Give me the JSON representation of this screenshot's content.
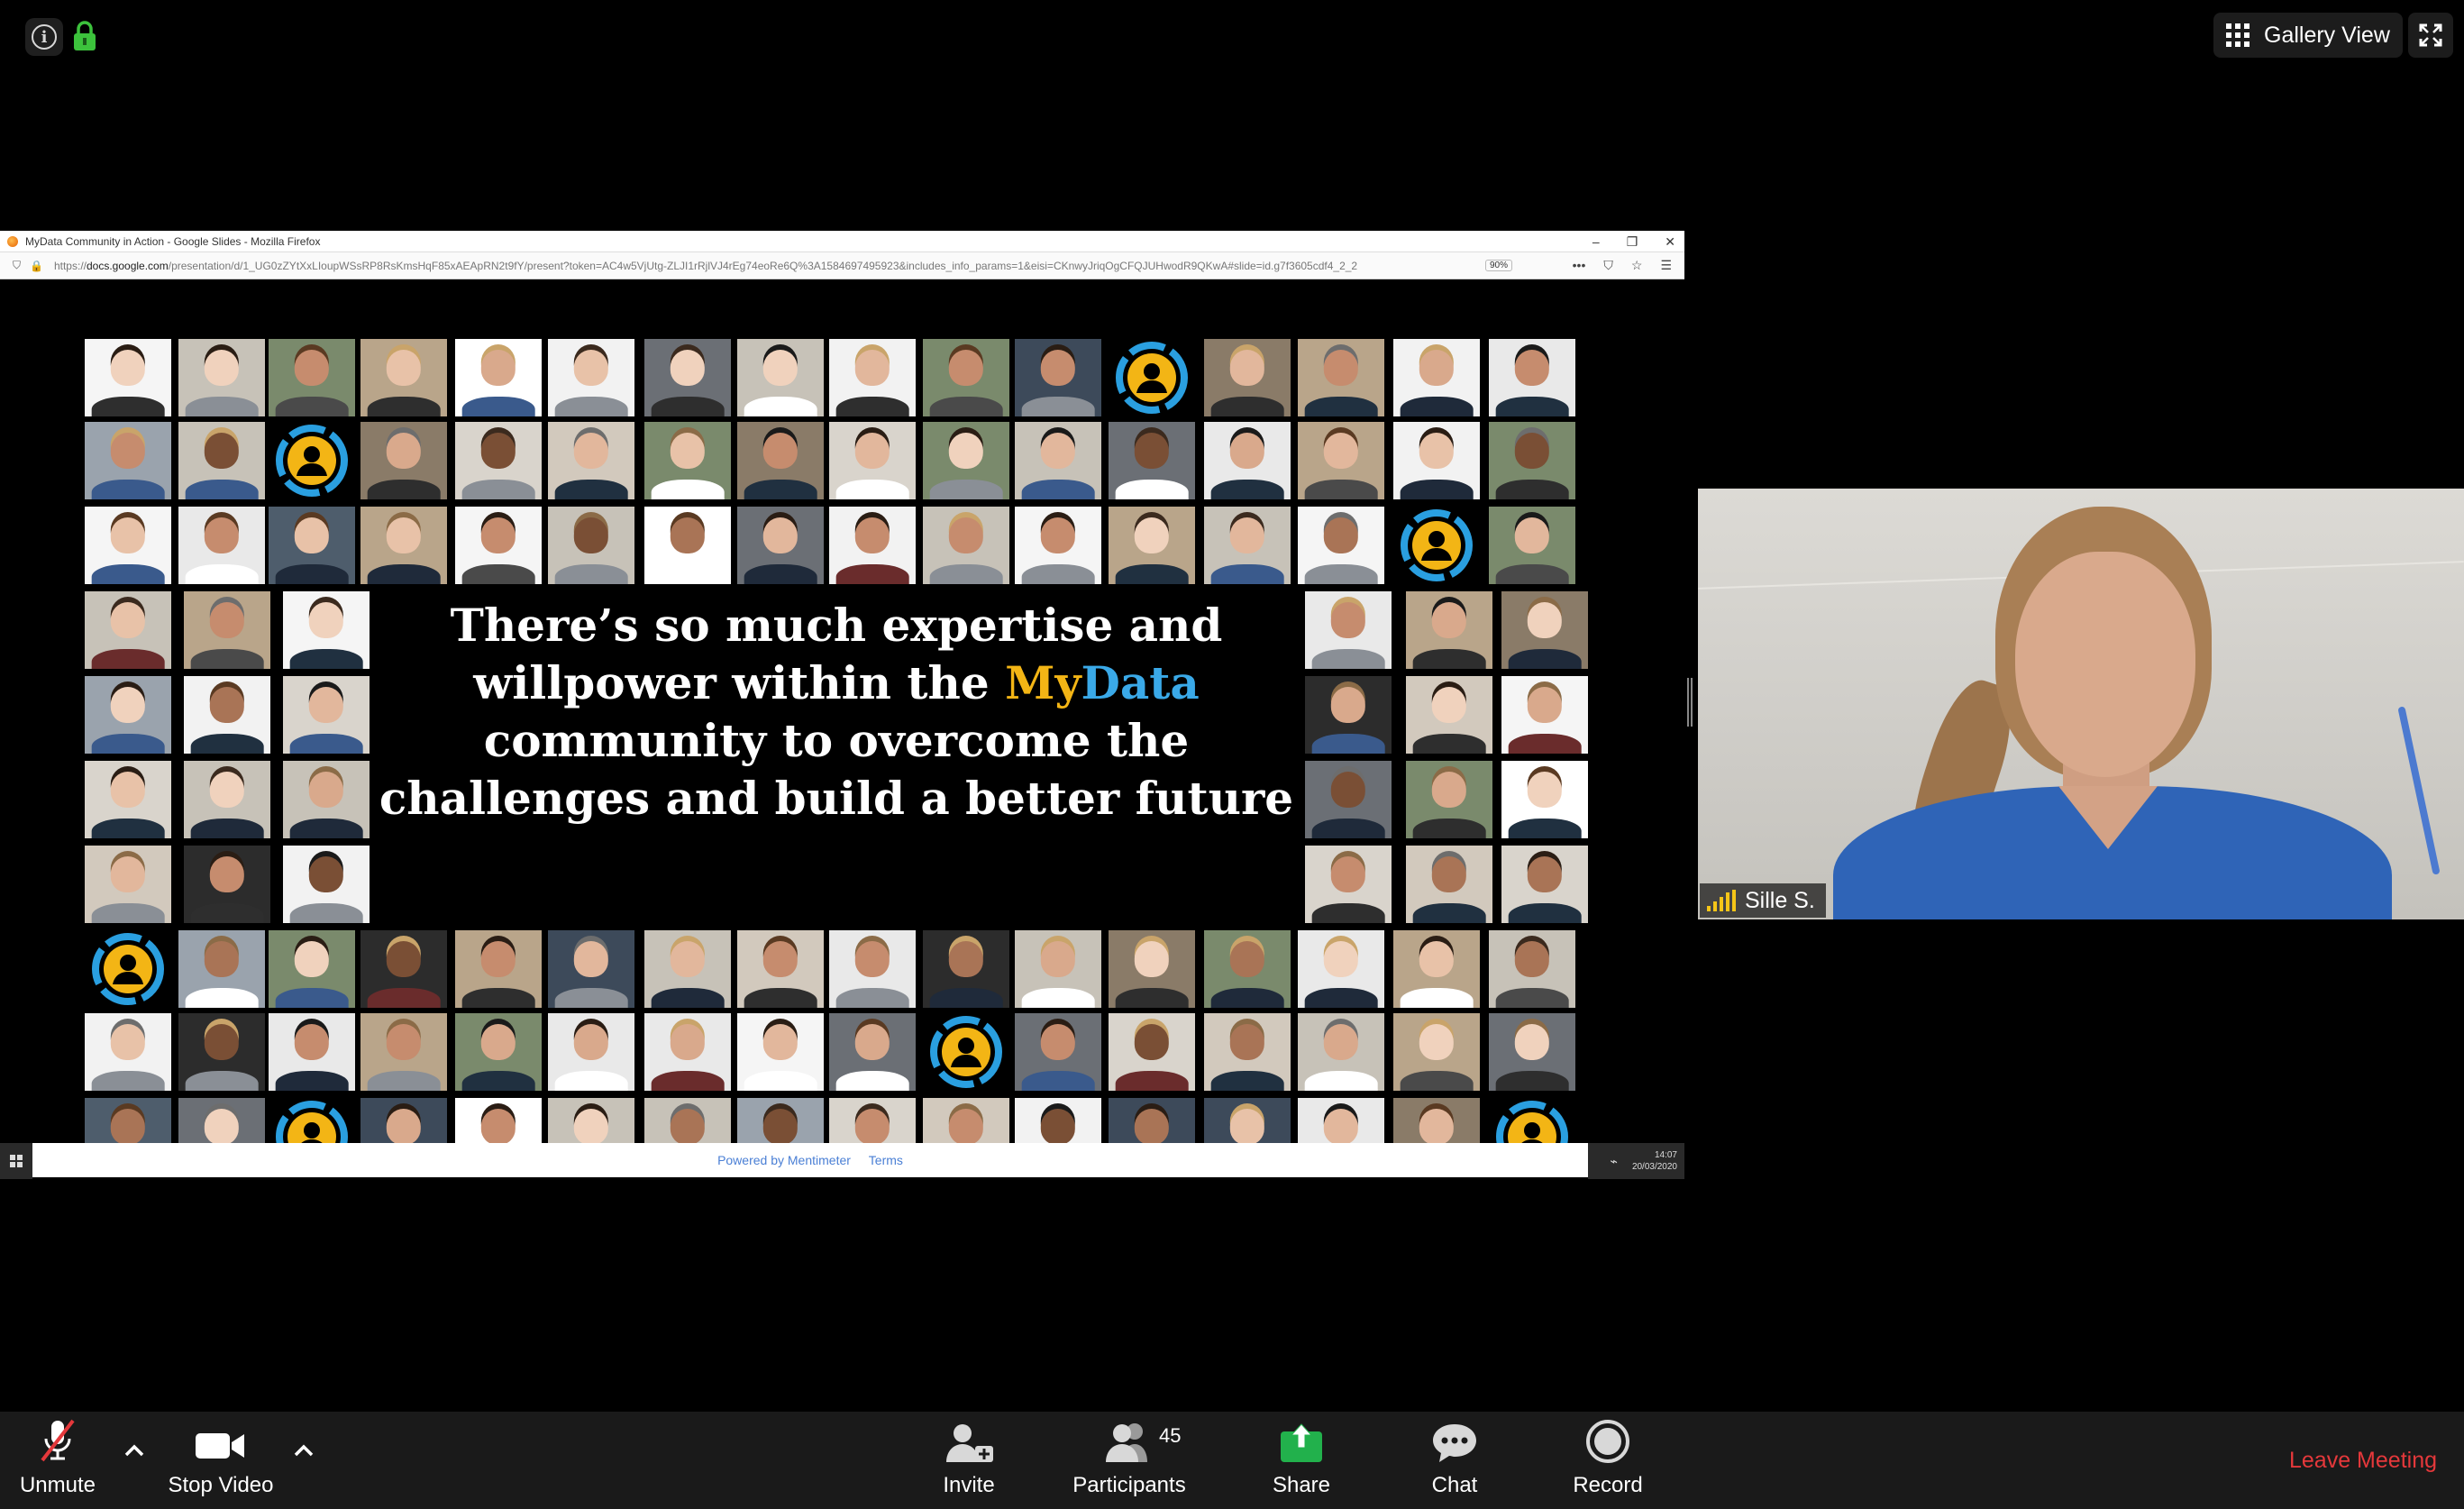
{
  "top_bar": {
    "gallery_view_label": "Gallery View"
  },
  "browser": {
    "title": "MyData Community in Action - Google Slides - Mozilla Firefox",
    "url_domain": "docs.google.com",
    "url_prefix": "https://",
    "url_rest": "/presentation/d/1_UG0zZYtXxLIoupWSsRP8RsKmsHqF85xAEApRN2t9fY/present?token=AC4w5VjUtg-ZLJI1rRjlVJ4rEg74eoRe6Q%3A1584697495923&includes_info_params=1&eisi=CKnwyJriqOgCFQJUHwodR9QKwA#slide=id.g7f3605cdf4_2_2",
    "zoom": "90%"
  },
  "slide": {
    "line1": "There’s so much expertise and",
    "line2_pre": "willpower within the ",
    "line2_my": "My",
    "line2_data": "Data",
    "line3": "community to overcome the",
    "line4": "challenges and build a better future",
    "footer_powered": "Powered by Mentimeter",
    "footer_terms": "Terms"
  },
  "taskbar": {
    "time": "14:07",
    "date": "20/03/2020"
  },
  "speaker": {
    "name": "Sille S."
  },
  "toolbar": {
    "unmute": "Unmute",
    "stop_video": "Stop Video",
    "invite": "Invite",
    "participants": "Participants",
    "participants_count": "45",
    "share": "Share",
    "chat": "Chat",
    "record": "Record",
    "leave": "Leave Meeting"
  },
  "colors": {
    "accent_my": "#f3b515",
    "accent_data": "#3aa9e8",
    "share_green": "#22b14c",
    "leave_red": "#e5383b"
  }
}
